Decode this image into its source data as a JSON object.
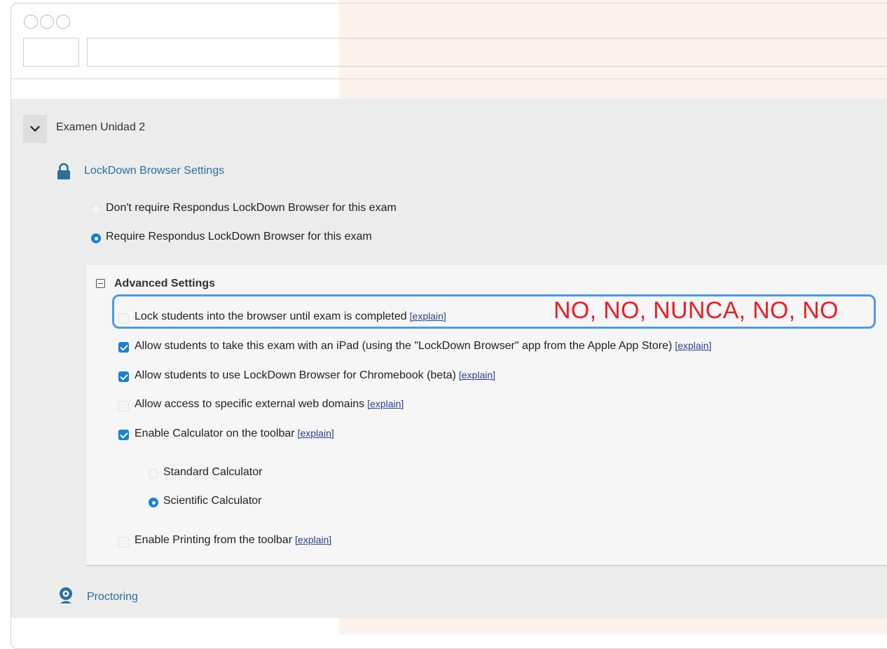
{
  "header": {
    "window_dots": 3
  },
  "exam": {
    "title": "Examen Unidad 2"
  },
  "lockdown": {
    "section_title": "LockDown Browser Settings",
    "options": [
      {
        "label": "Don't require Respondus LockDown Browser for this exam",
        "selected": false
      },
      {
        "label": "Require Respondus LockDown Browser for this exam",
        "selected": true
      }
    ]
  },
  "advanced": {
    "title": "Advanced Settings",
    "explain_label": "[explain]",
    "settings": [
      {
        "label": "Lock students into the browser until exam is completed",
        "checked": false,
        "has_explain": true
      },
      {
        "label": "Allow students to take this exam with an iPad (using the \"LockDown Browser\" app from the Apple App Store)",
        "checked": true,
        "has_explain": true
      },
      {
        "label": "Allow students to use LockDown Browser for Chromebook (beta)",
        "checked": true,
        "has_explain": true
      },
      {
        "label": "Allow access to specific external web domains",
        "checked": false,
        "has_explain": true
      },
      {
        "label": "Enable Calculator on the toolbar",
        "checked": true,
        "has_explain": true
      },
      {
        "label": "Enable Printing from the toolbar",
        "checked": false,
        "has_explain": true
      }
    ],
    "calculator_options": [
      {
        "label": "Standard Calculator",
        "selected": false
      },
      {
        "label": "Scientific Calculator",
        "selected": true
      }
    ]
  },
  "annotation": {
    "text": "NO, NO, NUNCA, NO, NO",
    "text_color": "#ee1c24",
    "box_color": "#4a9ae8"
  },
  "proctoring": {
    "label": "Proctoring"
  },
  "colors": {
    "accent": "#1a7fd6",
    "link": "#2c6f99",
    "explain_link": "#2a3f8f",
    "panel_bg": "#ececec",
    "right_bg": "#fbf2ee"
  }
}
